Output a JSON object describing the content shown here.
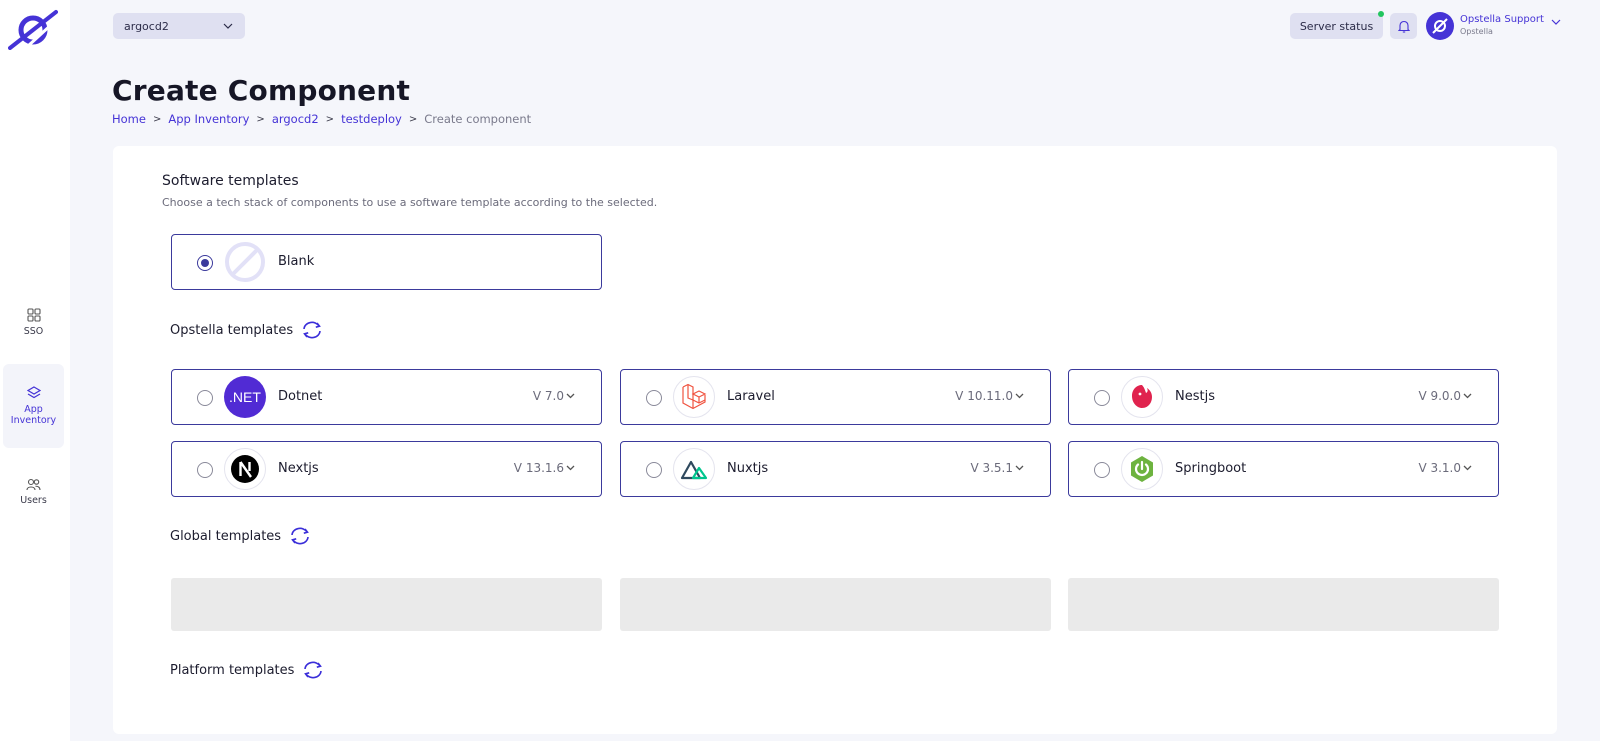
{
  "sidebar": {
    "items": [
      {
        "label": "SSO",
        "icon": "grid-icon"
      },
      {
        "label": "App Inventory",
        "icon": "layers-icon",
        "active": true
      },
      {
        "label": "Users",
        "icon": "users-icon"
      }
    ]
  },
  "topbar": {
    "environment": "argocd2",
    "server_status_label": "Server status",
    "status_color": "#22c55e",
    "user_name": "Opstella Support",
    "user_org": "Opstella"
  },
  "page": {
    "title": "Create Component",
    "breadcrumb": [
      "Home",
      "App Inventory",
      "argocd2",
      "testdeploy",
      "Create component"
    ]
  },
  "software_templates": {
    "title": "Software templates",
    "description": "Choose a tech stack of components to use a software template according to the selected.",
    "blank_label": "Blank"
  },
  "opstella_templates": {
    "title": "Opstella templates",
    "items": [
      {
        "name": "Dotnet",
        "version": "V 7.0",
        "icon": "dotnet-icon"
      },
      {
        "name": "Laravel",
        "version": "V 10.11.0",
        "icon": "laravel-icon"
      },
      {
        "name": "Nestjs",
        "version": "V 9.0.0",
        "icon": "nestjs-icon"
      },
      {
        "name": "Nextjs",
        "version": "V 13.1.6",
        "icon": "nextjs-icon"
      },
      {
        "name": "Nuxtjs",
        "version": "V 3.5.1",
        "icon": "nuxtjs-icon"
      },
      {
        "name": "Springboot",
        "version": "V 3.1.0",
        "icon": "springboot-icon"
      }
    ],
    "dotnet_badge": ".NET"
  },
  "global_templates": {
    "title": "Global templates"
  },
  "platform_templates": {
    "title": "Platform templates"
  },
  "colors": {
    "accent": "#4533d6",
    "border": "#3b3a9c"
  }
}
